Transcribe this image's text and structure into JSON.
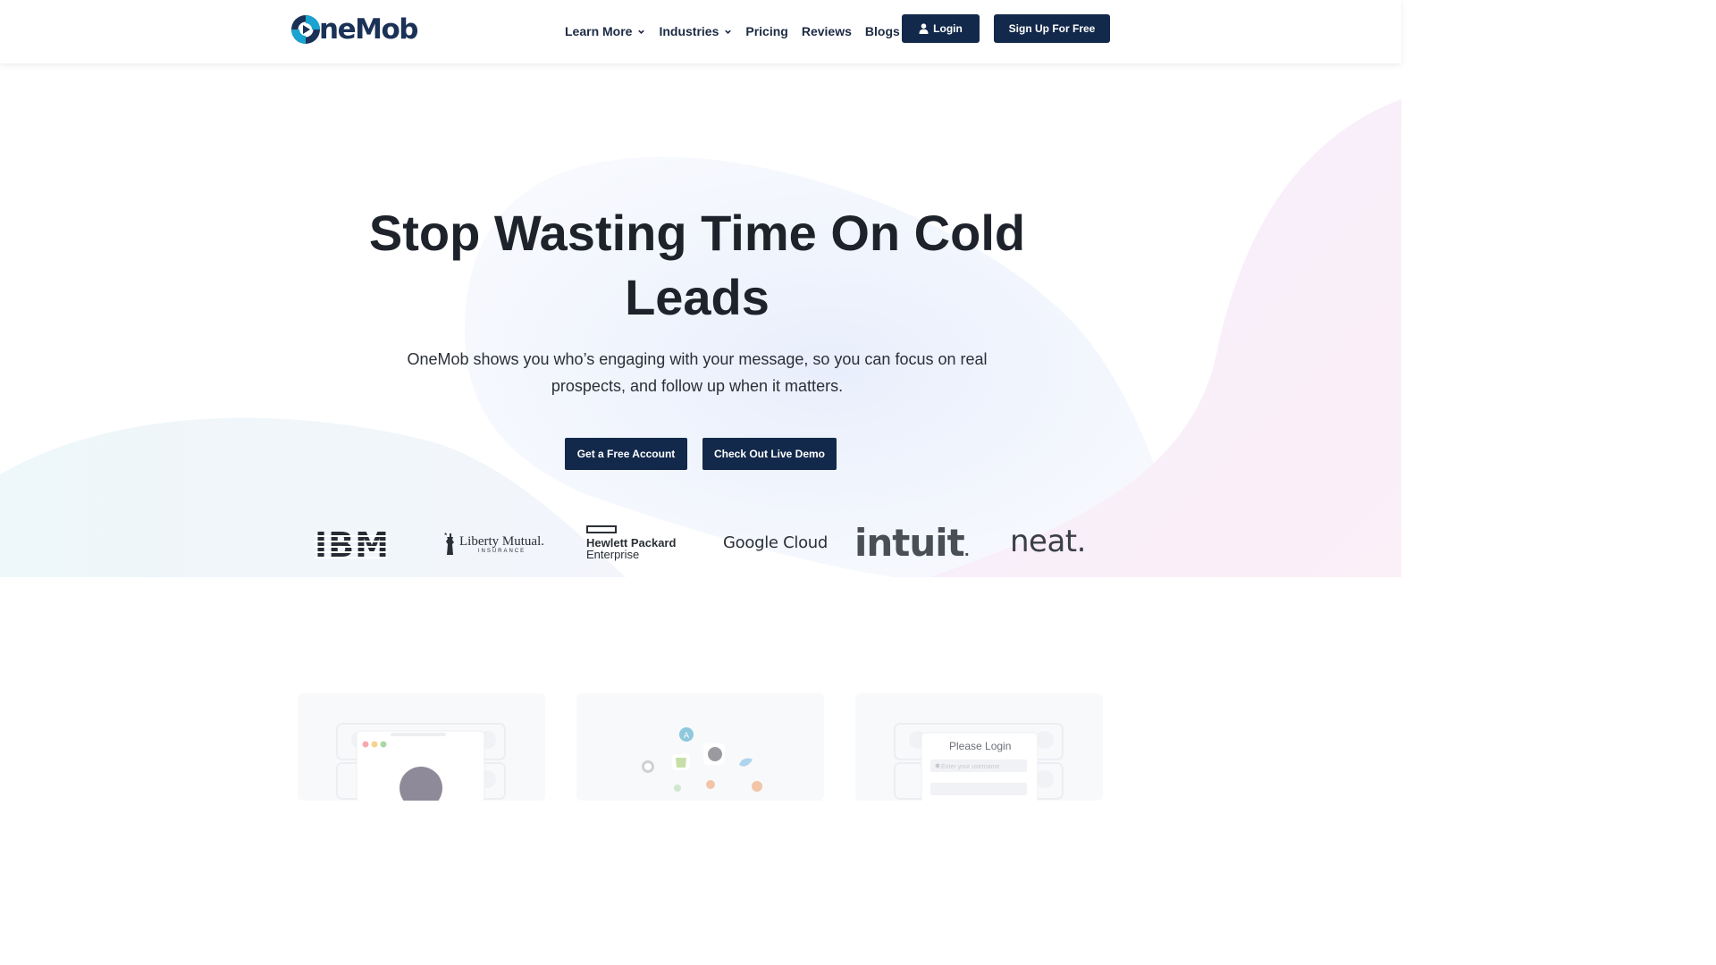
{
  "header": {
    "logo_text": "neMob",
    "nav": [
      {
        "label": "Learn More",
        "has_dropdown": true
      },
      {
        "label": "Industries",
        "has_dropdown": true
      },
      {
        "label": "Pricing",
        "has_dropdown": false
      },
      {
        "label": "Reviews",
        "has_dropdown": false
      },
      {
        "label": "Blogs",
        "has_dropdown": false
      }
    ],
    "login_label": "Login",
    "signup_label": "Sign Up For Free"
  },
  "hero": {
    "title": "Stop Wasting Time On Cold Leads",
    "subtitle": "OneMob shows you who’s engaging with your message, so you can focus on real prospects, and follow up when it matters.",
    "primary_cta": "Get a Free Account",
    "secondary_cta": "Check Out Live Demo"
  },
  "logos": {
    "ibm": "IBM",
    "liberty_main": "Liberty Mutual.",
    "liberty_sub": "INSURANCE",
    "hpe_line1": "Hewlett Packard",
    "hpe_line2": "Enterprise",
    "google": "Google Cloud",
    "intuit": "intuit",
    "intuit_dot": ".",
    "neat": "neat."
  },
  "cards": {
    "login_title": "Please Login",
    "login_placeholder": "Enter your username"
  },
  "colors": {
    "brand_navy": "#13294b",
    "logo_blue": "#1b3257",
    "logo_cyan": "#1aa3d0"
  },
  "icons": {
    "logo": "onemob-logo-icon",
    "user": "user-icon",
    "chevron": "chevron-down-icon"
  }
}
